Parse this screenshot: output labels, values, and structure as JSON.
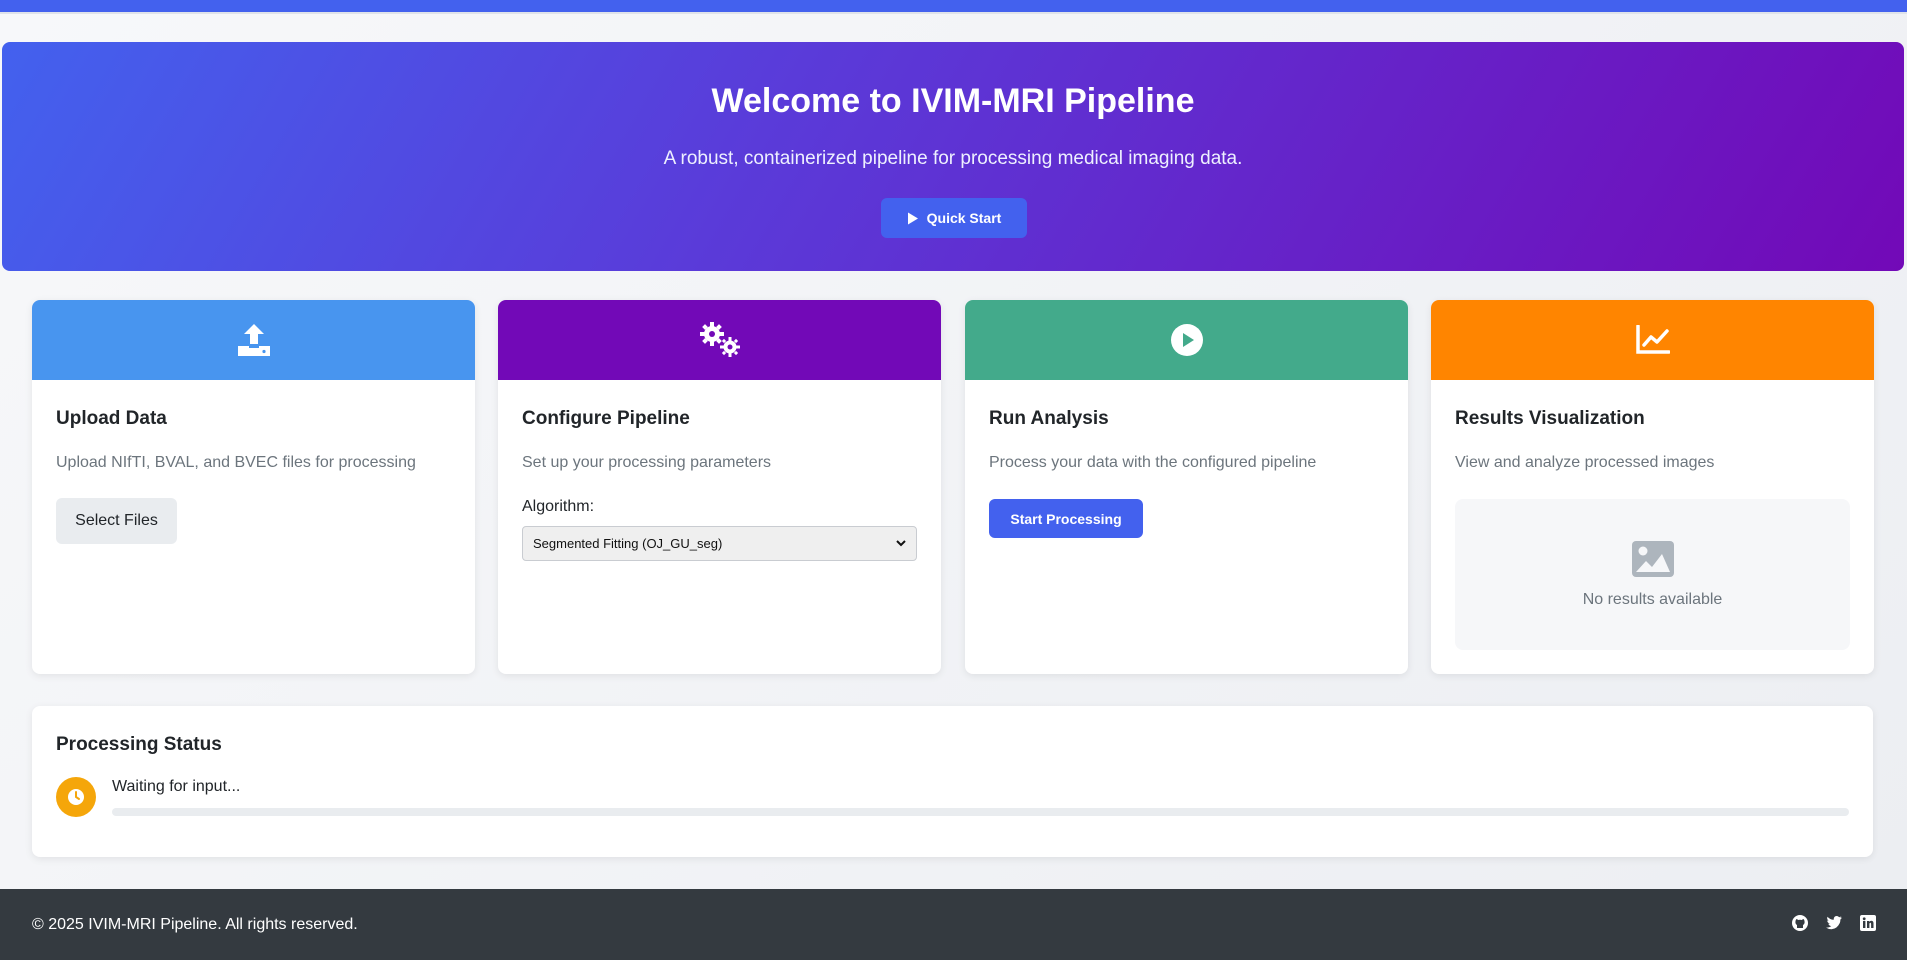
{
  "hero": {
    "title": "Welcome to IVIM-MRI Pipeline",
    "subtitle": "A robust, containerized pipeline for processing medical imaging data.",
    "quick_start_label": "Quick Start"
  },
  "cards": [
    {
      "title": "Upload Data",
      "description": "Upload NIfTI, BVAL, and BVEC files for processing",
      "button_label": "Select Files",
      "icon": "upload-icon",
      "color": "#4895ef"
    },
    {
      "title": "Configure Pipeline",
      "description": "Set up your processing parameters",
      "field_label": "Algorithm:",
      "selected_option": "Segmented Fitting (OJ_GU_seg)",
      "icon": "gears-icon",
      "color": "#7209b7"
    },
    {
      "title": "Run Analysis",
      "description": "Process your data with the configured pipeline",
      "button_label": "Start Processing",
      "icon": "play-circle-icon",
      "color": "#43aa8b"
    },
    {
      "title": "Results Visualization",
      "description": "View and analyze processed images",
      "empty_text": "No results available",
      "icon": "chart-line-icon",
      "color": "#ff8500"
    }
  ],
  "status": {
    "title": "Processing Status",
    "message": "Waiting for input...",
    "progress": 0,
    "icon": "clock-icon",
    "color": "#f5a60a"
  },
  "footer": {
    "copyright": "© 2025 IVIM-MRI Pipeline. All rights reserved.",
    "icons": [
      "github-icon",
      "twitter-icon",
      "linkedin-icon"
    ]
  },
  "colors": {
    "accent": "#4361ee",
    "hero_end": "#7209b7",
    "footer_bg": "#343a40"
  }
}
